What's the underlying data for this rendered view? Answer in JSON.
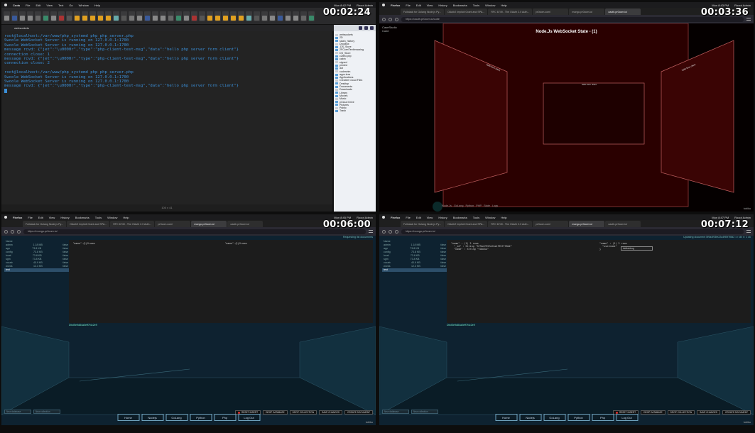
{
  "pane1": {
    "timestamp": "00:02:24",
    "menubar": {
      "app": "Coda",
      "items": [
        "File",
        "Edit",
        "View",
        "Text",
        "Go",
        "Window",
        "Help"
      ],
      "clock": "Mon 8:42 PM",
      "user": "Rooot Admin"
    },
    "tab": "websockets",
    "terminal_lines": [
      "root@localhost:/var/www/php_systemd php php_server.php",
      "Swoole WebSocket Server is running on 127.0.0.1:1700",
      "Swoole WebSocket Server is running on 127.0.0.1:1700",
      "message rcvd: {\"jet\":\"\\u0000r\",\"type\":\"php-client-test-msg\",\"data\":\"hello php server form client\"}",
      "connection close: 1",
      "message rcvd: {\"jet\":\"\\u0000r\",\"type\":\"php-client-test-msg\",\"data\":\"hello php server form client\"}",
      "connection close: 2",
      "",
      "root@localhost:/var/www/php_systemd php php_server.php",
      "Swoole WebSocket Server is running on 127.0.0.1:1700",
      "Swoole WebSocket Server is running on 127.0.0.1:1700",
      "message rcvd: {\"jet\":\"\\u0000r\",\"type\":\"php-client-test-msg\",\"data\":\"hello php server form client\"}"
    ],
    "status": "100 x 41",
    "filetree": [
      "websockets",
      "2D",
      "stash_history",
      "Dropbox",
      ".DS_Store",
      "2FCore/Textbrowsing",
      "DS_Store",
      "c2test.php",
      "cabin",
      "signed",
      "printed",
      "dot",
      "codenvim",
      "apps.tera",
      "Applications",
      "Creative Cloud Files",
      "Desktop",
      "Documents",
      "Downloads",
      "Library",
      "Movies",
      "Music",
      "pCloud Drive",
      "Pictures",
      "Public",
      "Trash"
    ]
  },
  "pane2": {
    "timestamp": "00:03:36",
    "menubar": {
      "app": "Firefox",
      "items": [
        "File",
        "Edit",
        "View",
        "History",
        "Bookmarks",
        "Tools",
        "Window",
        "Help"
      ],
      "clock": "Mon 8:43 PM",
      "user": "Rooot Admin"
    },
    "tabs": [
      "Fullstack for Golang Node.js Py...",
      "OAuth2 Implicit Grant and SPA...",
      "RFC 6749 - The OAuth 2.0 Auth...",
      "pr0com.com/",
      "mongo.pr0com.io/",
      "oauth.pr0com.io/"
    ],
    "url": "https://oauth.pr0com.io/cube",
    "title": "Node.Js WebSocket State - (1)",
    "left_label": [
      "CaseStudio",
      "Cube"
    ],
    "face_labels": {
      "left": "hello form client",
      "right": "hello form client",
      "center": "hello form client"
    },
    "bottom_nav": [
      "Node.Js",
      "GoLang",
      "Python",
      "PHP",
      "State",
      "Logs"
    ],
    "logo": "tobiku"
  },
  "pane3": {
    "timestamp": "00:06:00",
    "menubar": {
      "app": "Firefox",
      "items": [
        "File",
        "Edit",
        "View",
        "History",
        "Bookmarks",
        "Tools",
        "Window",
        "Help"
      ],
      "clock": "Mon 8:45 PM",
      "user": "Rooot Admin"
    },
    "tabs": [
      "Fullstack for Golang Node.js Py...",
      "OAuth2 Implicit Grant and SPA...",
      "RFC 6749 - The OAuth 2.0 Auth...",
      "pr0com.com/",
      "mongo.pr0com.io/",
      "oauth.pr0com.io/"
    ],
    "url": "https://mongo.pr0com.io/",
    "hint": "Requesting list documents",
    "db_header": "Name",
    "databases": [
      {
        "name": "admin",
        "size": "1.18 MB",
        "empty": "false"
      },
      {
        "name": "app",
        "size": "73.8 KB",
        "empty": "false"
      },
      {
        "name": "config",
        "size": "73.8 KB",
        "empty": "false"
      },
      {
        "name": "local",
        "size": "73.8 KB",
        "empty": "false"
      },
      {
        "name": "sgm",
        "size": "73.8 KB",
        "empty": "false"
      },
      {
        "name": "vocab",
        "size": "40.9 KB",
        "empty": "false"
      },
      {
        "name": "words",
        "size": "12.3 KB",
        "empty": "false"
      }
    ],
    "collection": "test",
    "panel_left_header": "\"name\" : (1) 0 rows",
    "panel_right_header": "\"name\" : (1) 0 rows",
    "status_id": "DbdSe9d84a0eff7f4c2e9",
    "inputs": [
      "New database",
      "New collection"
    ],
    "buttons": [
      "RESET INSERT",
      "DROP DATABASE",
      "DROP COLLECTION",
      "SAVE CHANGES",
      "CREATE DOCUMENT"
    ],
    "nav": [
      "Home",
      "Nodejs",
      "GoLang",
      "Python",
      "Php",
      "Log Out"
    ],
    "logo": "tobiku"
  },
  "pane4": {
    "timestamp": "00:07:12",
    "menubar": {
      "app": "Firefox",
      "items": [
        "File",
        "Edit",
        "View",
        "History",
        "Bookmarks",
        "Tools",
        "Window",
        "Help"
      ],
      "clock": "Mon 8:47 PM",
      "user": "Rooot Admin"
    },
    "tabs": [
      "Fullstack for Golang Node.js Py...",
      "OAuth2 Implicit Grant and SPA...",
      "RFC 6749 - The OAuth 2.0 Auth...",
      "pr0com.com/",
      "mongo.pr0com.io/",
      "oauth.pr0com.io/"
    ],
    "url": "https://mongo.pr0com.io/",
    "hint": "Updating document 5f9a4f93fe22a4f95f7f8d2 => ok! n: 1 ok",
    "db_header": "Name",
    "databases": [
      {
        "name": "admin",
        "size": "1.18 MB",
        "empty": "false"
      },
      {
        "name": "app",
        "size": "73.8 KB",
        "empty": "false"
      },
      {
        "name": "config",
        "size": "73.8 KB",
        "empty": "false"
      },
      {
        "name": "local",
        "size": "73.8 KB",
        "empty": "false"
      },
      {
        "name": "sgm",
        "size": "73.8 KB",
        "empty": "false"
      },
      {
        "name": "vocab",
        "size": "40.9 KB",
        "empty": "false"
      },
      {
        "name": "words",
        "size": "12.3 KB",
        "empty": "false"
      }
    ],
    "collection": "test",
    "json_left": "\"name\" : (1) 2 rows\n  \"_id\" : String \"5f9a4f93fe22a4f95f7f8d2\"\n  \"name\" : String \"tobiku\"",
    "json_right": "\"name\" : (1) 2 rows\n  \"username\"\n}",
    "edit_value": "tobikuhtrug",
    "status_id": "DbdSe9d84a0eff7f4c2e9",
    "inputs": [
      "New database",
      "New collection"
    ],
    "buttons": [
      "RESET INSERT",
      "DROP DATABASE",
      "DROP COLLECTION",
      "SAVE CHANGES",
      "CREATE DOCUMENT"
    ],
    "nav": [
      "Home",
      "Nodejs",
      "GoLang",
      "Python",
      "Php",
      "Log Out"
    ],
    "logo": "tobiku"
  }
}
